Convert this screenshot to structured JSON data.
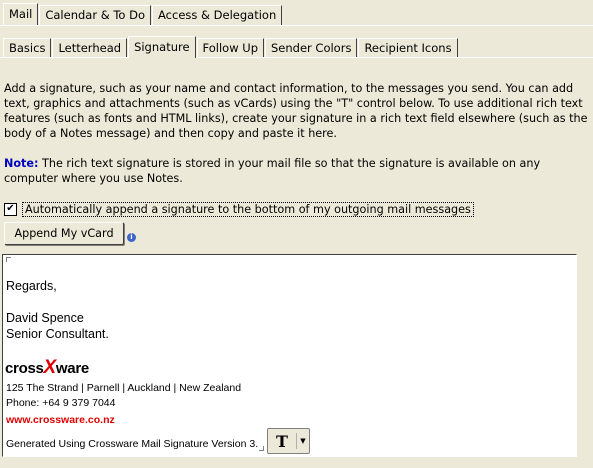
{
  "main_tabs": [
    "Mail",
    "Calendar & To Do",
    "Access & Delegation"
  ],
  "sub_tabs": [
    "Basics",
    "Letterhead",
    "Signature",
    "Follow Up",
    "Sender Colors",
    "Recipient Icons"
  ],
  "intro_text": "Add a signature, such as your name and contact information, to the messages you send.  You can add text, graphics and attachments (such as vCards) using the \"T\" control below.  To use additional rich text features (such as fonts and HTML links), create your signature in a rich text field elsewhere (such as the body of a Notes message) and then copy and paste it here.",
  "note_label": "Note:",
  "note_text": "The rich text signature is stored in your mail file so that the signature is available on any computer where you use Notes.",
  "auto_append": {
    "checked": true,
    "label": "Automatically append a signature to the bottom of my outgoing mail messages"
  },
  "vcard_button": "Append My vCard",
  "signature": {
    "greeting": "Regards,",
    "name": "David Spence",
    "title": "Senior Consultant.",
    "logo_pre": "cross",
    "logo_x": "X",
    "logo_post": "ware",
    "address": "125 The Strand | Parnell | Auckland | New Zealand",
    "phone": "Phone: +64 9 379 7044",
    "website": "www.crossware.co.nz",
    "generated": "Generated Using Crossware Mail Signature Version 3."
  },
  "text_button": "T"
}
